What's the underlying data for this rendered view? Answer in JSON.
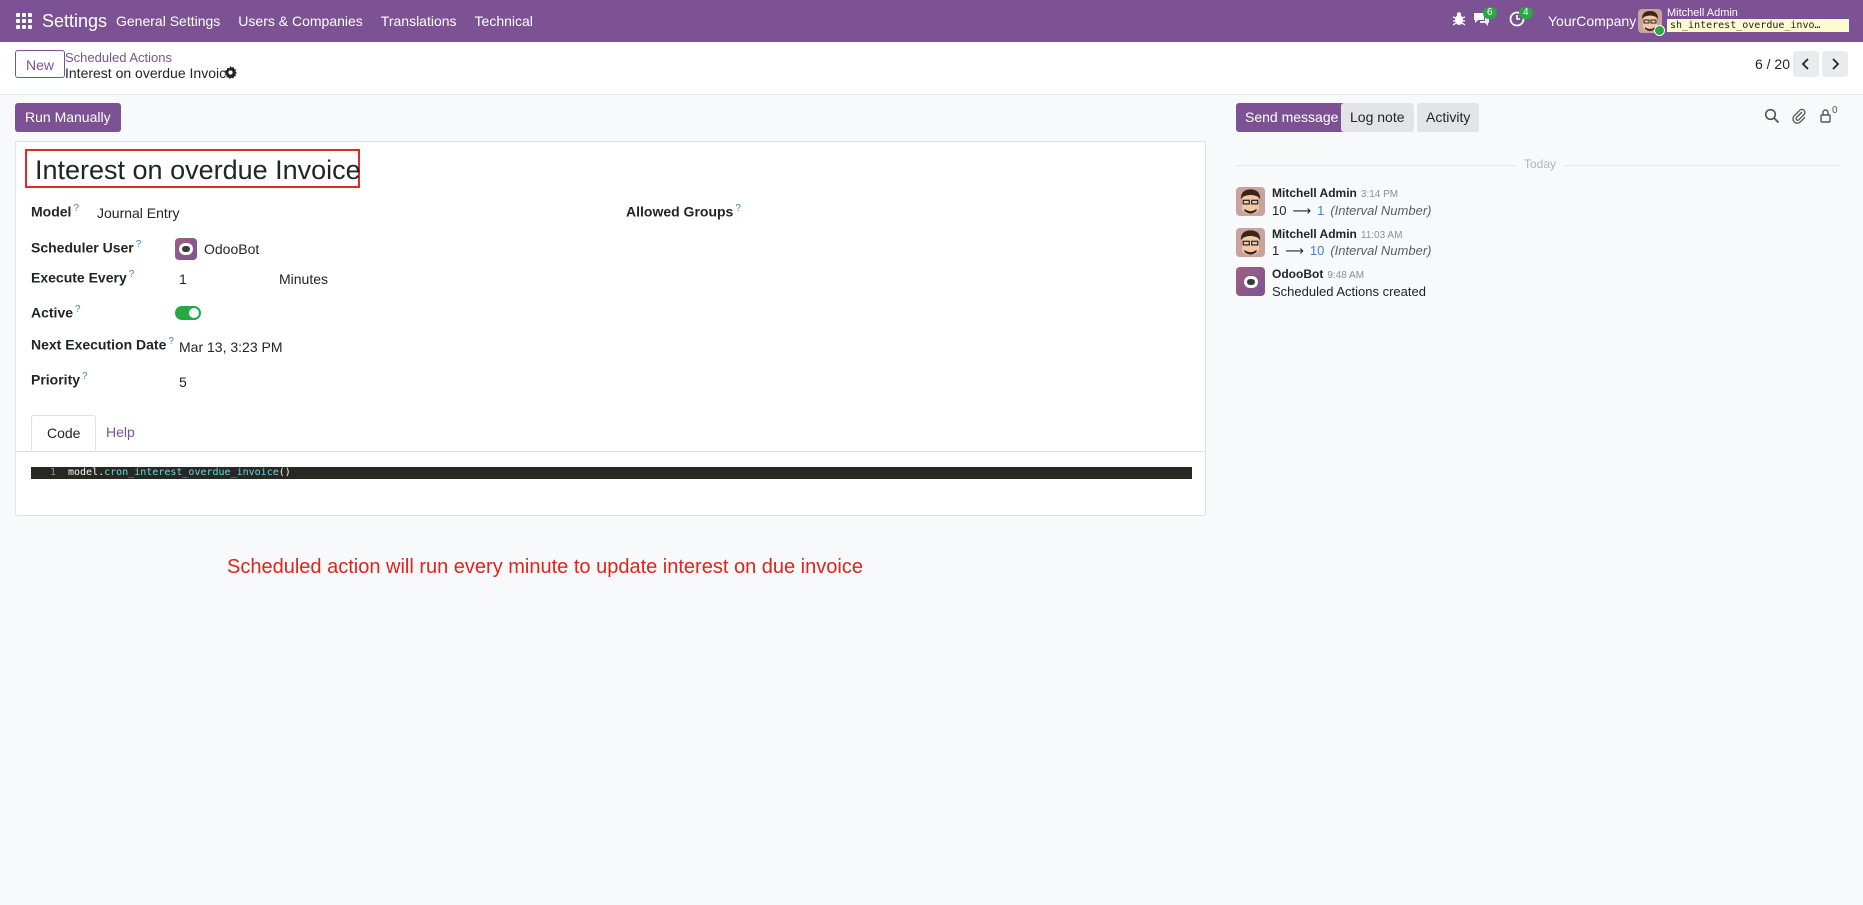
{
  "navbar": {
    "brand": "Settings",
    "menu": [
      "General Settings",
      "Users & Companies",
      "Translations",
      "Technical"
    ],
    "messages_badge": "6",
    "activities_badge": "4",
    "company": "YourCompany",
    "user_name": "Mitchell Admin",
    "database": "sh_interest_overdue_invo…"
  },
  "control_panel": {
    "new_label": "New",
    "breadcrumb_parent": "Scheduled Actions",
    "breadcrumb_current": "Interest on overdue Invoice",
    "pager": "6 / 20"
  },
  "form": {
    "run_label": "Run Manually",
    "title": "Interest on overdue Invoice",
    "fields": {
      "model_label": "Model",
      "model_value": "Journal Entry",
      "allowed_groups_label": "Allowed Groups",
      "scheduler_user_label": "Scheduler User",
      "scheduler_user_value": "OdooBot",
      "execute_every_label": "Execute Every",
      "execute_every_number": "1",
      "execute_every_unit": "Minutes",
      "active_label": "Active",
      "active_value": true,
      "next_execution_label": "Next Execution Date",
      "next_execution_value": "Mar 13, 3:23 PM",
      "priority_label": "Priority",
      "priority_value": "5",
      "help_mark": "?"
    },
    "tabs": [
      "Code",
      "Help"
    ],
    "code": {
      "line_number": "1",
      "object": "model",
      "dot": ".",
      "method": "cron_interest_overdue_invoice",
      "parens": "()"
    }
  },
  "annotation": "Scheduled action will run every minute to update interest on due invoice",
  "chatter": {
    "send_message": "Send message",
    "log_note": "Log note",
    "activity": "Activity",
    "followers_count": "0",
    "date_separator": "Today",
    "messages": [
      {
        "author": "Mitchell Admin",
        "time": "3:14 PM",
        "old": "10",
        "arrow": "⟶",
        "new": "1",
        "field": "(Interval Number)"
      },
      {
        "author": "Mitchell Admin",
        "time": "11:03 AM",
        "old": "1",
        "arrow": "⟶",
        "new": "10",
        "field": "(Interval Number)"
      },
      {
        "author": "OdooBot",
        "time": "9:48 AM",
        "text": "Scheduled Actions created"
      }
    ]
  },
  "colors": {
    "brand_purple": "#7c5295",
    "annotation_red": "#e0241a",
    "toggle_green": "#28a745"
  }
}
